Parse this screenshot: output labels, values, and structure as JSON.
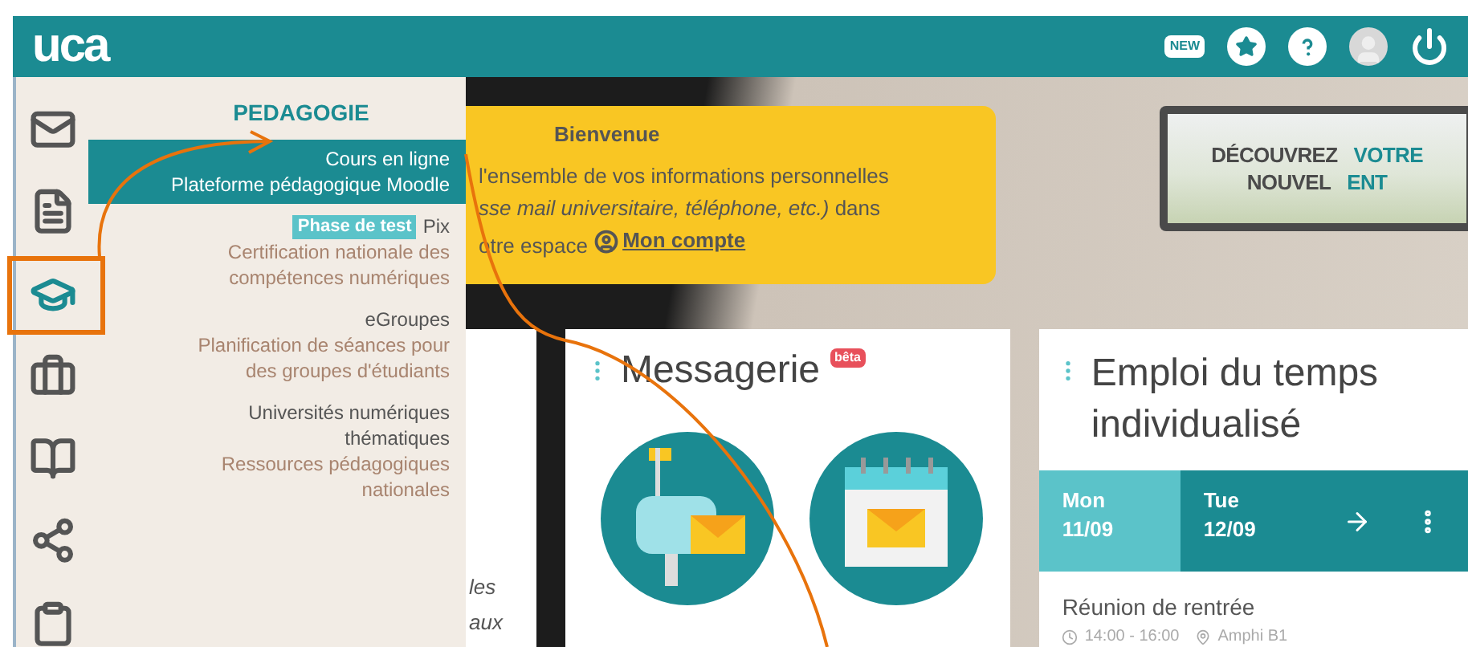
{
  "header": {
    "logo": "uca",
    "badge": "NEW"
  },
  "sidebar": {
    "items": [
      {
        "selected": false
      },
      {
        "selected": false
      },
      {
        "selected": true
      },
      {
        "selected": false
      },
      {
        "selected": false
      },
      {
        "selected": false
      },
      {
        "selected": false
      }
    ]
  },
  "menu": {
    "title": "PEDAGOGIE",
    "items": [
      {
        "title": "Cours en ligne",
        "subtitle": "Plateforme pédagogique Moodle",
        "selected": true
      },
      {
        "title": "Pix",
        "badge": "Phase de test",
        "subtitle": "Certification nationale des compétences numériques",
        "selected": false
      },
      {
        "title": "eGroupes",
        "subtitle": "Planification de séances pour des groupes d'étudiants",
        "selected": false
      },
      {
        "title": "Universités numériques thématiques",
        "subtitle": "Ressources pédagogiques nationales",
        "selected": false
      }
    ]
  },
  "welcome": {
    "title": "Bienvenue",
    "lines": [
      "l'ensemble de vos informations personnelles",
      "*sse mail universitaire, téléphone, etc.)* dans",
      "otre espace"
    ],
    "link": "Mon compte"
  },
  "promo": {
    "lines": [
      [
        {
          "text": "DÉCOUVREZ",
          "accent": false
        },
        {
          "text": "VOTRE",
          "accent": true
        }
      ],
      [
        {
          "text": "NOUVEL",
          "accent": false
        },
        {
          "text": "ENT",
          "accent": true
        }
      ]
    ]
  },
  "hidden_card": {
    "fragments": [
      "les",
      "aux"
    ]
  },
  "messagerie": {
    "title": "Messagerie",
    "badge": "bêta"
  },
  "schedule": {
    "title": "Emploi du temps individualisé",
    "days": [
      {
        "day": "Mon",
        "date": "11/09",
        "selected": true
      },
      {
        "day": "Tue",
        "date": "12/09",
        "selected": false
      }
    ],
    "event": {
      "title": "Réunion de rentrée",
      "time": "14:00 - 16:00",
      "place": "Amphi B1"
    }
  }
}
